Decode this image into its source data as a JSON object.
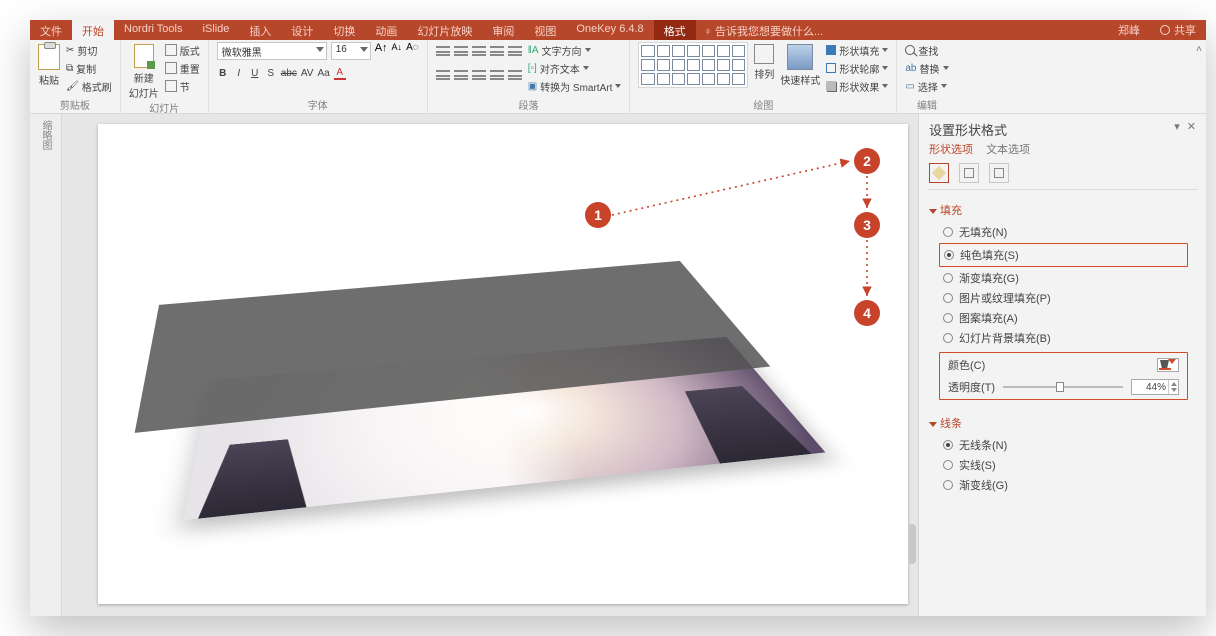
{
  "tabs": {
    "file": "文件",
    "home": "开始",
    "nordri": "Nordri Tools",
    "islide": "iSlide",
    "insert": "插入",
    "design": "设计",
    "transition": "切换",
    "animation": "动画",
    "slideshow": "幻灯片放映",
    "review": "审阅",
    "view": "视图",
    "onekey": "OneKey 6.4.8",
    "format": "格式",
    "tellme": "告诉我您想要做什么...",
    "user": "郑峰",
    "share": "共享"
  },
  "ribbon": {
    "clipboard": {
      "paste": "粘贴",
      "cut": "剪切",
      "copy": "复制",
      "painter": "格式刷",
      "label": "剪贴板"
    },
    "slides": {
      "new": "新建\n幻灯片",
      "layout": "版式",
      "reset": "重置",
      "section": "节",
      "label": "幻灯片"
    },
    "font": {
      "name": "微软雅黑",
      "size": "16",
      "b": "B",
      "i": "I",
      "u": "U",
      "s": "S",
      "abc": "abc",
      "av": "AV",
      "aa": "Aa",
      "label": "字体"
    },
    "paragraph": {
      "dir": "文字方向",
      "align": "对齐文本",
      "smart": "转换为 SmartArt",
      "label": "段落"
    },
    "drawing": {
      "arrange": "排列",
      "quick": "快速样式",
      "fill": "形状填充",
      "outline": "形状轮廓",
      "effects": "形状效果",
      "label": "绘图"
    },
    "editing": {
      "find": "查找",
      "replace": "替换",
      "select": "选择",
      "label": "编辑"
    }
  },
  "formatPane": {
    "title": "设置形状格式",
    "tab_shape": "形状选项",
    "tab_text": "文本选项",
    "fill": {
      "header": "填充",
      "none": "无填充(N)",
      "solid": "纯色填充(S)",
      "gradient": "渐变填充(G)",
      "picture": "图片或纹理填充(P)",
      "pattern": "图案填充(A)",
      "slidebg": "幻灯片背景填充(B)",
      "color": "颜色(C)",
      "transparency": "透明度(T)",
      "pct": "44%"
    },
    "line": {
      "header": "线条",
      "none": "无线条(N)",
      "solid": "实线(S)",
      "gradient": "渐变线(G)"
    }
  },
  "annotations": {
    "1": "1",
    "2": "2",
    "3": "3",
    "4": "4"
  },
  "outline_tab": "缩略图"
}
